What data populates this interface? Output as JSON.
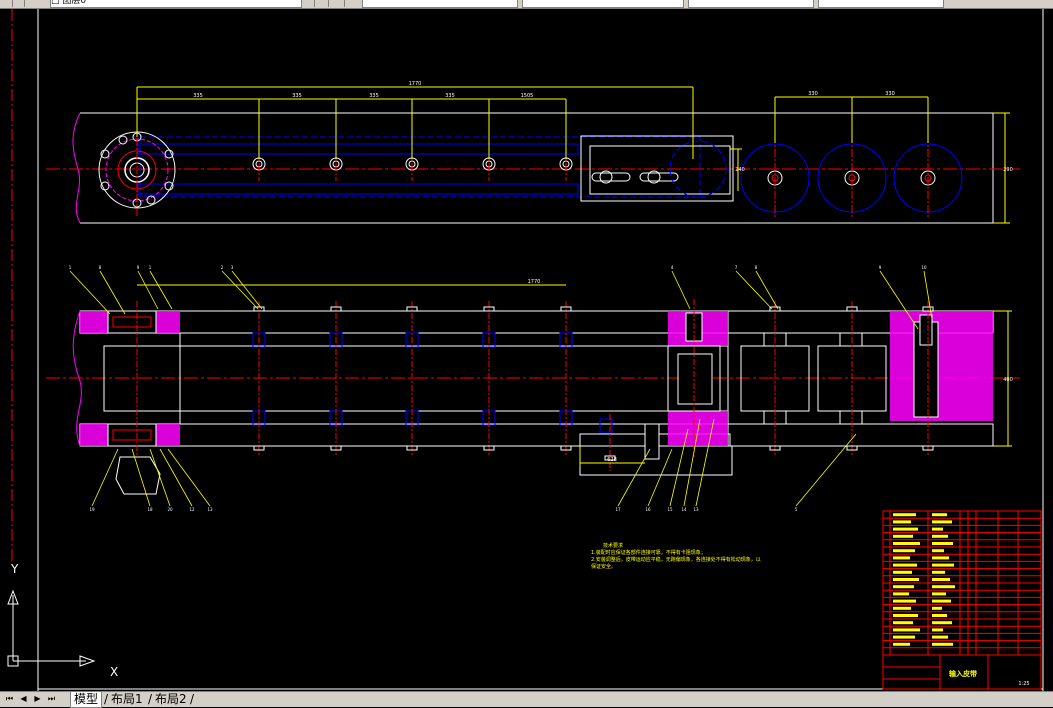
{
  "toolbar": {
    "layer_text": "□ 图层0",
    "fields": [
      "",
      "",
      "",
      "",
      "",
      ""
    ]
  },
  "drawing": {
    "title_block_name": "输入皮带",
    "scale_text": "1:25",
    "tech_req_title": "技术要求",
    "tech_req_line1": "1.装配时应保证各部件连接可靠，不得有卡阻现象；",
    "tech_req_line2": "2.安装调整后，皮带运动应平稳，无跑偏现象，各连接处不得有松动现象，以",
    "tech_req_line3": "保证安全。",
    "axis_x": "X",
    "axis_y": "Y",
    "dims_top": [
      "1770",
      "335",
      "335",
      "335",
      "335",
      "1505",
      "330",
      "330"
    ],
    "dims_side": [
      "290",
      "240",
      "400"
    ],
    "dim_overall_bottom": "1770",
    "dim_small_bottom": "628",
    "balloons_top": [
      "1",
      "8",
      "9",
      "1",
      "2",
      "3",
      "4",
      "7",
      "8",
      "9",
      "10",
      "11"
    ],
    "balloons_bottom": [
      "19",
      "18",
      "20",
      "12",
      "13",
      "17",
      "16",
      "15",
      "14",
      "13",
      "5",
      "6"
    ],
    "accent_colors": {
      "border": "#ffffff",
      "dimension": "#ffff00",
      "centerline": "#ff0000",
      "hidden": "#0000ff",
      "section": "#ff00ff",
      "leader": "#00ff00"
    }
  },
  "layout_tabs": {
    "model": "模型",
    "layout1": "布局1",
    "layout2": "布局2"
  },
  "nav": {
    "first": "⏮",
    "prev": "◀",
    "next": "▶",
    "last": "⏭"
  }
}
